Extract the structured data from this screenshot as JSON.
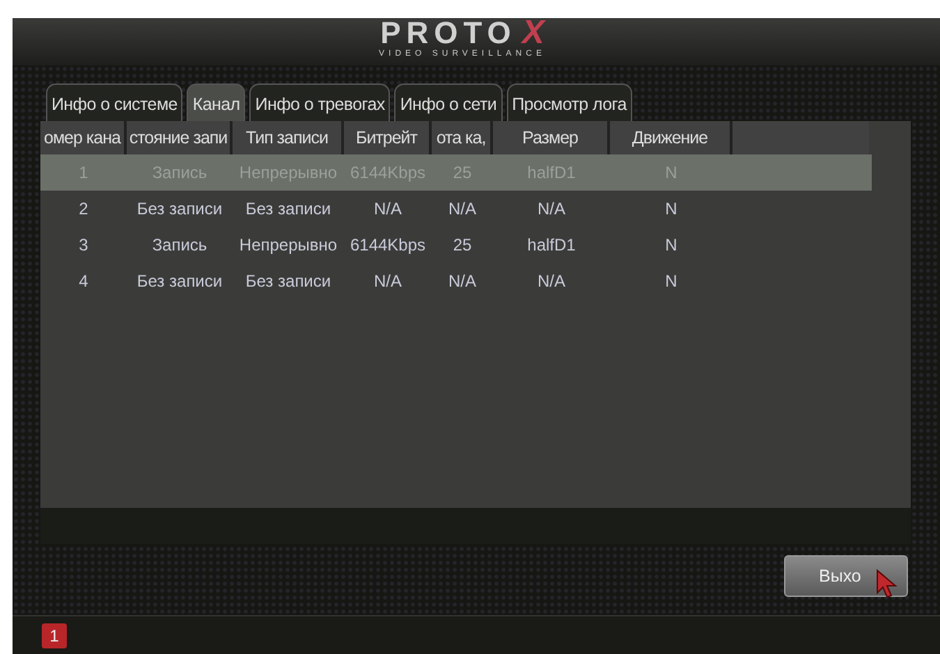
{
  "header": {
    "logo": "PROTO",
    "logo_mark": "X",
    "tagline": "VIDEO SURVEILLANCE"
  },
  "tabs": [
    {
      "label": "Инфо о системе",
      "selected": false
    },
    {
      "label": "Канал",
      "selected": true
    },
    {
      "label": "Инфо о тревогах",
      "selected": false
    },
    {
      "label": "Инфо о сети",
      "selected": false
    },
    {
      "label": "Просмотр лога",
      "selected": false
    }
  ],
  "table": {
    "columns": [
      "омер кана",
      "стояние запи",
      "Тип записи",
      "Битрейт",
      "ота ка,",
      "Размер",
      "Движение"
    ],
    "rows": [
      {
        "selected": true,
        "cells": [
          "1",
          "Запись",
          "Непрерывно",
          "6144Kbps",
          "25",
          "halfD1",
          "N"
        ]
      },
      {
        "selected": false,
        "cells": [
          "2",
          "Без записи",
          "Без записи",
          "N/A",
          "N/A",
          "N/A",
          "N"
        ]
      },
      {
        "selected": false,
        "cells": [
          "3",
          "Запись",
          "Непрерывно",
          "6144Kbps",
          "25",
          "halfD1",
          "N"
        ]
      },
      {
        "selected": false,
        "cells": [
          "4",
          "Без записи",
          "Без записи",
          "N/A",
          "N/A",
          "N/A",
          "N"
        ]
      }
    ]
  },
  "exit_button": "Выхо",
  "status_bar": {
    "badge": "1"
  }
}
